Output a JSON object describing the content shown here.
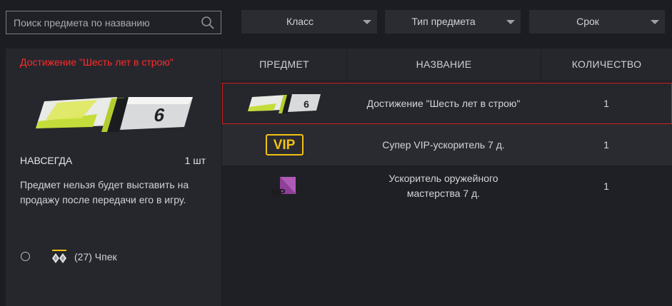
{
  "search": {
    "placeholder": "Поиск предмета по названию"
  },
  "filters": [
    {
      "label": "Класс"
    },
    {
      "label": "Тип предмета"
    },
    {
      "label": "Срок"
    }
  ],
  "details": {
    "title": "Достижение \"Шесть лет в строю\"",
    "duration": "НАВСЕГДА",
    "quantity": "1 шт",
    "note": "Предмет нельзя будет выставить на продажу после передачи его в игру.",
    "player": "(27) Чпек"
  },
  "table": {
    "headers": [
      "ПРЕДМЕТ",
      "НАЗВАНИЕ",
      "КОЛИЧЕСТВО"
    ],
    "rows": [
      {
        "icon": "six-years-badge-icon",
        "name": "Достижение \"Шесть лет в строю\"",
        "quantity": "1",
        "selected": true
      },
      {
        "icon": "vip-icon",
        "icon_text": "VIP",
        "name": "Супер VIP-ускоритель 7 д.",
        "quantity": "1",
        "selected": false
      },
      {
        "icon": "mp-icon",
        "icon_text": "MP",
        "name": "Ускоритель оружейного мастерства 7 д.",
        "quantity": "1",
        "selected": false
      }
    ]
  },
  "colors": {
    "accent_red": "#ff2a2a",
    "selection_border": "#d11c1c",
    "vip_gold": "#f2c014",
    "mp_purple": "#b05ab8"
  }
}
